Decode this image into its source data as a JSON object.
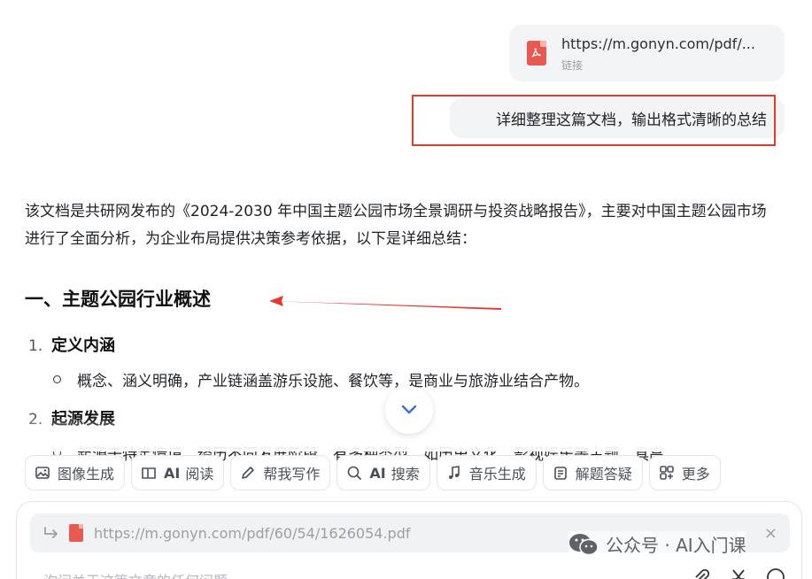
{
  "link_card": {
    "url": "https://m.gonyn.com/pdf/...",
    "subtitle": "链接"
  },
  "user_message": "详细整理这篇文档，输出格式清晰的总结",
  "answer": {
    "intro": "该文档是共研网发布的《2024-2030 年中国主题公园市场全景调研与投资战略报告》，主要对中国主题公园市场进行了全面分析，为企业布局提供决策参考依据，以下是详细总结：",
    "section1_title": "一、主题公园行业概述",
    "items": [
      {
        "num": "1.",
        "title": "定义内涵",
        "bullet": "概念、涵义明确，产业链涵盖游乐设施、餐饮等，是商业与旅游业结合产物。"
      },
      {
        "num": "2.",
        "title": "起源发展",
        "bullet": "起源于特定情境，经历不同发展阶段，有多种类型，如历史文化、影视娱乐等主题，具高"
      }
    ]
  },
  "toolbar": [
    {
      "icon": "image-gen-icon",
      "label": "图像生成"
    },
    {
      "icon": "ai-read-icon",
      "prefix": "AI",
      "label": "阅读"
    },
    {
      "icon": "pen-icon",
      "label": "帮我写作"
    },
    {
      "icon": "ai-search-icon",
      "prefix": "AI",
      "label": "搜索"
    },
    {
      "icon": "music-icon",
      "label": "音乐生成"
    },
    {
      "icon": "solve-icon",
      "label": "解题答疑"
    },
    {
      "icon": "more-icon",
      "label": "更多"
    }
  ],
  "composer": {
    "attachment_url": "https://m.gonyn.com/pdf/60/54/1626054.pdf",
    "placeholder": "询问关于这篇文章的任何问题"
  },
  "watermark": "公众号 · AI入门课",
  "colors": {
    "accent_red": "#e8382c",
    "pdf_red": "#e85a4f",
    "link_blue": "#3b6fe0"
  }
}
